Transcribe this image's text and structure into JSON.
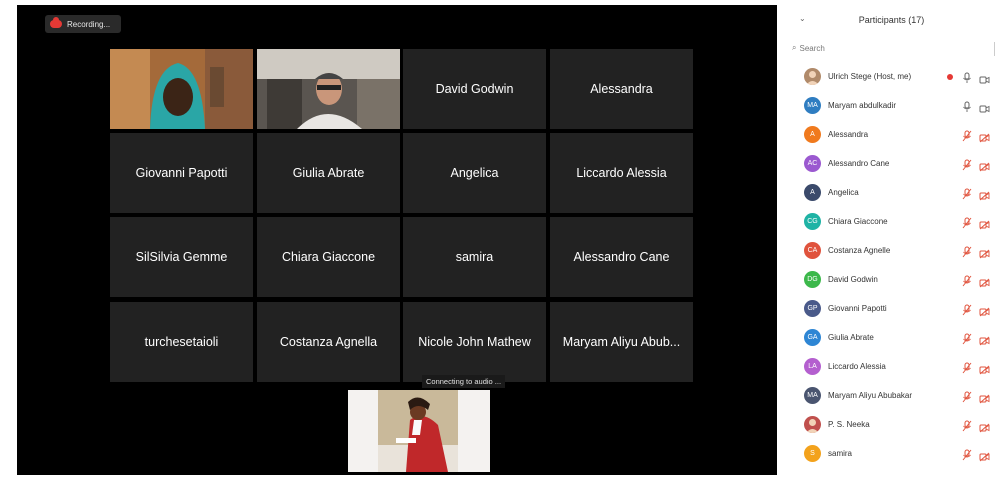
{
  "recording": {
    "label": "Recording..."
  },
  "gallery": {
    "tiles": [
      {
        "name": "",
        "type": "video-hijab"
      },
      {
        "name": "",
        "type": "video-man"
      },
      {
        "name": "David Godwin"
      },
      {
        "name": "Alessandra"
      },
      {
        "name": "Giovanni Papotti"
      },
      {
        "name": "Giulia Abrate"
      },
      {
        "name": "Angelica"
      },
      {
        "name": "Liccardo Alessia"
      },
      {
        "name": "SilSilvia Gemme"
      },
      {
        "name": "Chiara Giaccone"
      },
      {
        "name": "samira"
      },
      {
        "name": "Alessandro Cane"
      },
      {
        "name": "turchesetaioli"
      },
      {
        "name": "Costanza Agnella"
      },
      {
        "name": "Nicole John Mathew"
      },
      {
        "name": "Maryam Aliyu Abub..."
      }
    ],
    "connecting_label": "Connecting to audio ...",
    "active_color": "#c8e04a"
  },
  "participants_panel": {
    "title": "Participants (17)",
    "search_placeholder": "Search",
    "participants": [
      {
        "initials": "",
        "name": "Ulrich Stege (Host, me)",
        "color": "#b08a6a",
        "photo": true,
        "mic": "on",
        "cam": "off",
        "recording": true
      },
      {
        "initials": "MA",
        "name": "Maryam abdulkadir",
        "color": "#2f7dc1",
        "mic": "on",
        "cam": "off"
      },
      {
        "initials": "A",
        "name": "Alessandra",
        "color": "#f07a1e",
        "mic": "muted",
        "cam": "muted"
      },
      {
        "initials": "AC",
        "name": "Alessandro Cane",
        "color": "#9b59d0",
        "mic": "muted",
        "cam": "muted"
      },
      {
        "initials": "A",
        "name": "Angelica",
        "color": "#3b4a6b",
        "mic": "muted",
        "cam": "muted"
      },
      {
        "initials": "CG",
        "name": "Chiara Giaccone",
        "color": "#1fb3a5",
        "mic": "muted",
        "cam": "muted"
      },
      {
        "initials": "CA",
        "name": "Costanza Agnelle",
        "color": "#e0533d",
        "mic": "muted",
        "cam": "muted"
      },
      {
        "initials": "DG",
        "name": "David Godwin",
        "color": "#3cb84b",
        "mic": "muted",
        "cam": "muted"
      },
      {
        "initials": "GP",
        "name": "Giovanni Papotti",
        "color": "#4a5a8a",
        "mic": "muted",
        "cam": "muted"
      },
      {
        "initials": "GA",
        "name": "Giulia Abrate",
        "color": "#2e86d4",
        "mic": "muted",
        "cam": "muted"
      },
      {
        "initials": "LA",
        "name": "Liccardo Alessia",
        "color": "#b45fcf",
        "mic": "muted",
        "cam": "muted"
      },
      {
        "initials": "MA",
        "name": "Maryam Aliyu Abubakar",
        "color": "#4a5570",
        "mic": "muted",
        "cam": "muted"
      },
      {
        "initials": "",
        "name": "P. S. Neeka",
        "color": "#c0504d",
        "photo": true,
        "mic": "muted",
        "cam": "muted"
      },
      {
        "initials": "S",
        "name": "samira",
        "color": "#f3a21c",
        "mic": "muted",
        "cam": "muted"
      }
    ]
  }
}
